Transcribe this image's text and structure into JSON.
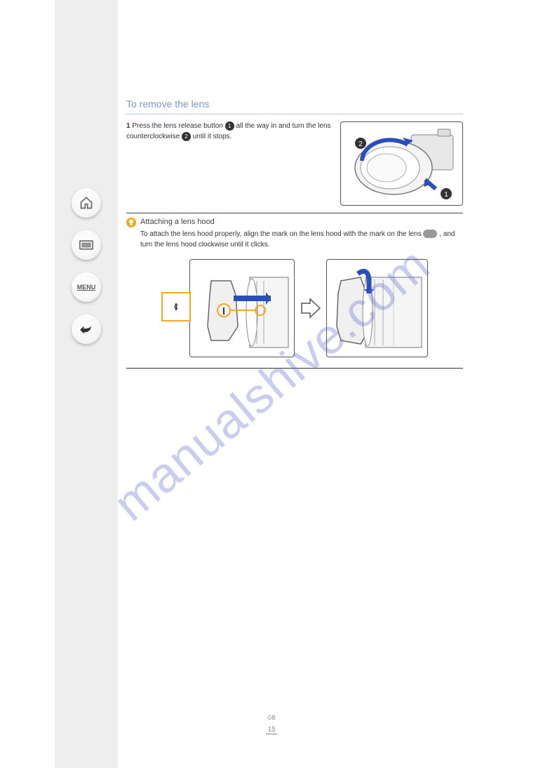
{
  "nav": {
    "home": "home-icon",
    "list": "list-icon",
    "menu": "MENU",
    "back": "back-icon"
  },
  "section": {
    "title": "To remove the lens",
    "step_prefix": "1",
    "step_text_a": "Press the lens release button",
    "step_num1": "1",
    "step_text_b": "all the way in and turn the lens counterclockwise",
    "step_num2": "2",
    "step_text_c": "until it stops."
  },
  "tip": {
    "title": "Attaching a lens hood",
    "body_a": "To attach the lens hood properly, align the mark on the lens hood with the mark on the lens",
    "mark_label": "C",
    "body_b": ", and turn the lens hood clockwise until it clicks."
  },
  "footer": {
    "page": "15",
    "lang": "GB"
  },
  "watermark": "manualshive.com"
}
